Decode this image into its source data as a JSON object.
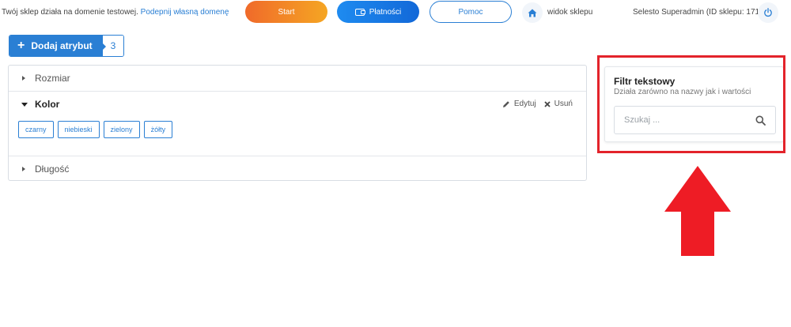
{
  "topbar": {
    "notice_text": "Twój sklep działa na domenie testowej. ",
    "notice_link": "Podepnij własną domenę",
    "start_label": "Start",
    "payments_label": "Płatności",
    "help_label": "Pomoc",
    "home_icon": "home-icon",
    "view_shop_label": "widok sklepu",
    "admin_label": "Selesto Superadmin (ID sklepu: 171)",
    "power_icon": "power-icon"
  },
  "toolbar": {
    "add_attribute_label": "Dodaj atrybut",
    "attribute_count": "3"
  },
  "attributes": [
    {
      "name": "Rozmiar",
      "expanded": false
    },
    {
      "name": "Kolor",
      "expanded": true,
      "edit_label": "Edytuj",
      "delete_label": "Usuń",
      "values": [
        "czarny",
        "niebieski",
        "zielony",
        "żółty"
      ]
    },
    {
      "name": "Długość",
      "expanded": false
    }
  ],
  "filter": {
    "title": "Filtr tekstowy",
    "subtitle": "Działa zarówno na nazwy jak i wartości",
    "placeholder": "Szukaj ..."
  },
  "colors": {
    "accent": "#2a7fd4",
    "start_gradient_from": "#f06a2a",
    "start_gradient_to": "#f5a623",
    "highlight": "#e3232b"
  }
}
